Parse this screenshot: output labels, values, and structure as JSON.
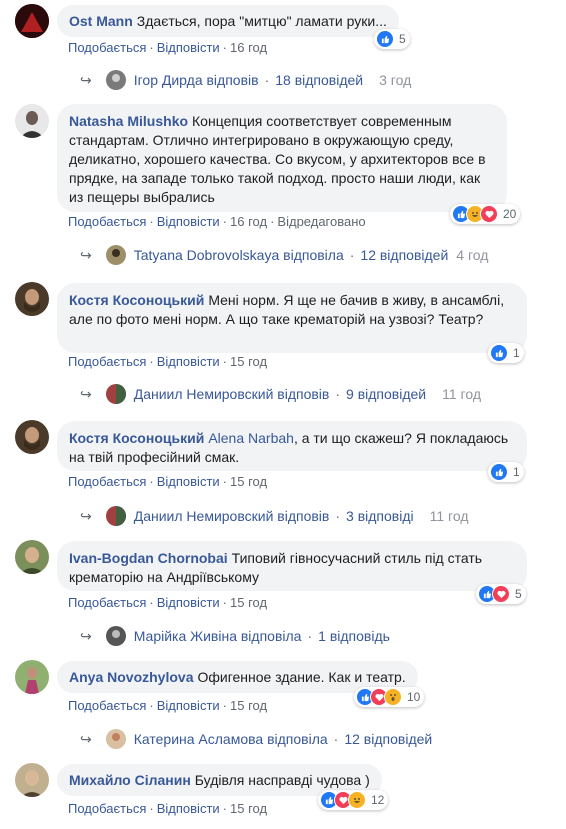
{
  "like_label": "Подобається",
  "reply_label": "Відповісти",
  "comments": [
    {
      "author": "Ost Mann",
      "text": "Здається, пора \"митцю\" ламати руки...",
      "time": "16 год",
      "reaction_count": "5",
      "reply": {
        "name": "Ігор Дирда відповів",
        "count": "18 відповідей",
        "time": "3 год"
      }
    },
    {
      "author": "Natasha Milushko",
      "text": "Концепция соответствует современным стандартам. Отлично интегрировано в окружающую среду, деликатно, хорошего качества. Со вкусом, у архитекторов все в прядке, на западе только такой подход. просто наши люди, как из пещеры выбрались",
      "time": "16 год",
      "edited": "Відредаговано",
      "reaction_count": "20",
      "reply": {
        "name": "Tatyana Dobrovolskaya відповіла",
        "count": "12 відповідей",
        "time": "4 год"
      }
    },
    {
      "author": "Костя Косоноцький",
      "text": "Мені норм. Я ще не бачив в живу, в ансамблі, але по фото мені норм. А що таке крематорій на узвозі? Театр?",
      "time": "15 год",
      "reaction_count": "1",
      "reply": {
        "name": "Даниил Немировский відповів",
        "count": "9 відповідей",
        "time": "11 год"
      }
    },
    {
      "author": "Костя Косоноцький",
      "mention": "Alena Narbah",
      "text": ", а ти що скажеш? Я покладаюсь на твій професійний смак.",
      "time": "15 год",
      "reaction_count": "1",
      "reply": {
        "name": "Даниил Немировский відповів",
        "count": "3 відповіді",
        "time": "11 год"
      }
    },
    {
      "author": "Ivan-Bogdan Chornobai",
      "text": "Типовий гівносучасний стиль під стать крематорію на Андріївському",
      "time": "15 год",
      "reaction_count": "5",
      "reply": {
        "name": "Марійка Живіна відповіла",
        "count": "1 відповідь"
      }
    },
    {
      "author": "Anya Novozhylova",
      "text": "Офигенное здание. Как и театр.",
      "time": "15 год",
      "reaction_count": "10",
      "reply": {
        "name": "Катерина Асламова відповіла",
        "count": "12 відповідей"
      }
    },
    {
      "author": "Михайло Сіланин",
      "text": "Будівля насправді чудова )",
      "time": "15 год",
      "reaction_count": "12"
    }
  ]
}
